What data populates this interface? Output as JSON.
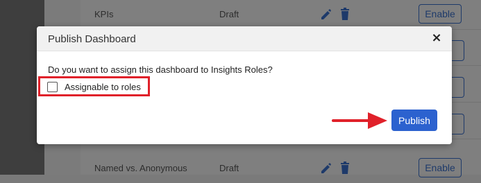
{
  "background": {
    "rows": [
      {
        "name": "KPIs",
        "status": "Draft",
        "action": "Enable"
      },
      {
        "name": "Named vs. Anonymous",
        "status": "Draft",
        "action": "Enable"
      }
    ]
  },
  "modal": {
    "title": "Publish Dashboard",
    "close_glyph": "×",
    "question": "Do you want to assign this dashboard to Insights Roles?",
    "checkbox": {
      "label": "Assignable to roles",
      "checked": false
    },
    "publish_label": "Publish"
  },
  "annotations": {
    "highlight_color": "#e0212a",
    "arrow_color": "#e0212a"
  },
  "colors": {
    "primary": "#2c62cf",
    "icon_blue": "#1e3a6a"
  },
  "icons": [
    "pencil-icon",
    "trash-icon",
    "close-icon",
    "arrow-right-icon"
  ]
}
